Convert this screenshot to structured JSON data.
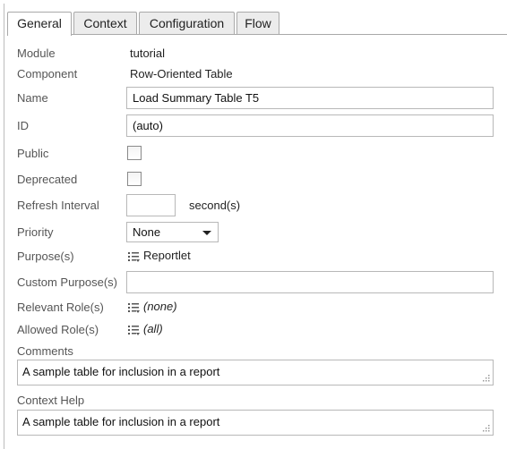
{
  "tabs": [
    {
      "label": "General",
      "active": true
    },
    {
      "label": "Context",
      "active": false
    },
    {
      "label": "Configuration",
      "active": false
    },
    {
      "label": "Flow",
      "active": false
    }
  ],
  "fields": {
    "module": {
      "label": "Module",
      "value": "tutorial"
    },
    "component": {
      "label": "Component",
      "value": "Row-Oriented Table"
    },
    "name": {
      "label": "Name",
      "value": "Load Summary Table T5"
    },
    "id": {
      "label": "ID",
      "value": "(auto)"
    },
    "public": {
      "label": "Public",
      "checked": false
    },
    "deprecated": {
      "label": "Deprecated",
      "checked": false
    },
    "refresh": {
      "label": "Refresh Interval",
      "value": "",
      "unit": "second(s)"
    },
    "priority": {
      "label": "Priority",
      "value": "None"
    },
    "purposes": {
      "label": "Purpose(s)",
      "value": "Reportlet",
      "icon": "list-icon"
    },
    "custom_purpose": {
      "label": "Custom Purpose(s)",
      "value": ""
    },
    "relevant_roles": {
      "label": "Relevant Role(s)",
      "value": "(none)",
      "icon": "list-icon"
    },
    "allowed_roles": {
      "label": "Allowed Role(s)",
      "value": "(all)",
      "icon": "list-icon"
    },
    "comments": {
      "label": "Comments",
      "value": "A sample table for inclusion in a report"
    },
    "context_help": {
      "label": "Context Help",
      "value": "A sample table for inclusion in a report"
    }
  }
}
